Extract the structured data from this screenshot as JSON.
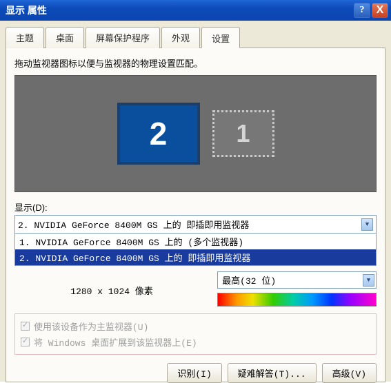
{
  "titlebar": {
    "title": "显示 属性",
    "help_symbol": "?",
    "close_symbol": "X"
  },
  "tabs": [
    {
      "label": "主题",
      "active": false
    },
    {
      "label": "桌面",
      "active": false
    },
    {
      "label": "屏幕保护程序",
      "active": false
    },
    {
      "label": "外观",
      "active": false
    },
    {
      "label": "设置",
      "active": true
    }
  ],
  "panel": {
    "help_text": "拖动监视器图标以便与监视器的物理设置匹配。",
    "monitors": {
      "primary_label": "2",
      "secondary_label": "1"
    },
    "display_label": "显示(D):",
    "display_combo": {
      "selected": "2. NVIDIA GeForce 8400M GS 上的 即插即用监视器",
      "options": [
        {
          "text": "1. NVIDIA GeForce 8400M GS 上的 (多个监视器)",
          "highlighted": false
        },
        {
          "text": "2. NVIDIA GeForce 8400M GS 上的 即插即用监视器",
          "highlighted": true
        }
      ]
    },
    "resolution_text": "1280 x 1024 像素",
    "color_quality": {
      "value": "最高(32 位)"
    },
    "checkboxes": [
      {
        "label": "使用该设备作为主监视器(U)",
        "checked": true,
        "disabled": true
      },
      {
        "label": "将 Windows 桌面扩展到该监视器上(E)",
        "checked": true,
        "disabled": true
      }
    ],
    "buttons": {
      "identify": "识别(I)",
      "troubleshoot": "疑难解答(T)...",
      "advanced": "高级(V)"
    }
  }
}
